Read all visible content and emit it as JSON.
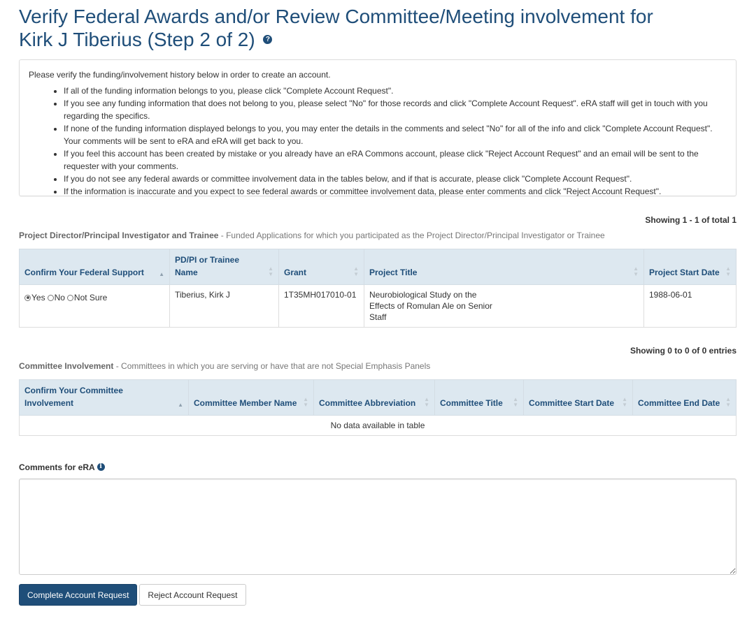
{
  "header": {
    "title_line1": "Verify Federal Awards and/or Review Committee/Meeting involvement for",
    "title_name": "Kirk J Tiberius",
    "title_step": "(Step 2 of 2)",
    "help_icon": "question-circle-icon"
  },
  "instructions": {
    "intro": "Please verify the funding/involvement history below in order to create an account.",
    "items": [
      "If all of the funding information belongs to you, please click \"Complete Account Request\".",
      "If you see any funding information that does not belong to you, please select \"No\" for those records and click \"Complete Account Request\". eRA staff will get in touch with you regarding the specifics.",
      "If none of the funding information displayed belongs to you, you may enter the details in the comments and select \"No\" for all of the info and click \"Complete Account Request\". Your comments will be sent to eRA and eRA will get back to you.",
      "If you feel this account has been created by mistake or you already have an eRA Commons account, please click \"Reject Account Request\" and an email will be sent to the requester with your comments.",
      "If you do not see any federal awards or committee involvement data in the tables below, and if that is accurate, please click \"Complete Account Request\".",
      "If the information is inaccurate and you expect to see federal awards or committee involvement data, please enter comments and click \"Reject Account Request\"."
    ]
  },
  "funding": {
    "showing": "Showing 1 - 1 of total 1",
    "heading_bold": "Project Director/Principal Investigator and Trainee",
    "heading_desc": " - Funded Applications for which you participated as the Project Director/Principal Investigator or Trainee",
    "columns": [
      "Confirm Your Federal Support",
      "PD/PI or Trainee Name",
      "Grant",
      "Project Title",
      "Project Start Date"
    ],
    "radio_options": [
      "Yes",
      "No",
      "Not Sure"
    ],
    "rows": [
      {
        "selected": "Yes",
        "name": "Tiberius, Kirk J",
        "grant": "1T35MH017010-01",
        "title": "Neurobiological Study on the Effects of Romulan Ale on Senior Staff",
        "start_date": "1988-06-01"
      }
    ]
  },
  "committee": {
    "showing": "Showing 0 to 0 of 0 entries",
    "heading_bold": "Committee Involvement",
    "heading_desc": " - Committees in which you are serving or have that are not Special Emphasis Panels",
    "columns": [
      "Confirm Your Committee Involvement",
      "Committee Member Name",
      "Committee Abbreviation",
      "Committee Title",
      "Committee Start Date",
      "Committee End Date"
    ],
    "empty_message": "No data available in table"
  },
  "comments": {
    "label": "Comments for eRA",
    "info_icon": "info-circle-icon",
    "value": ""
  },
  "actions": {
    "complete_label": "Complete Account Request",
    "reject_label": "Reject Account Request"
  },
  "colors": {
    "brand": "#1f4e79",
    "table_header_bg": "#dde8f0"
  }
}
